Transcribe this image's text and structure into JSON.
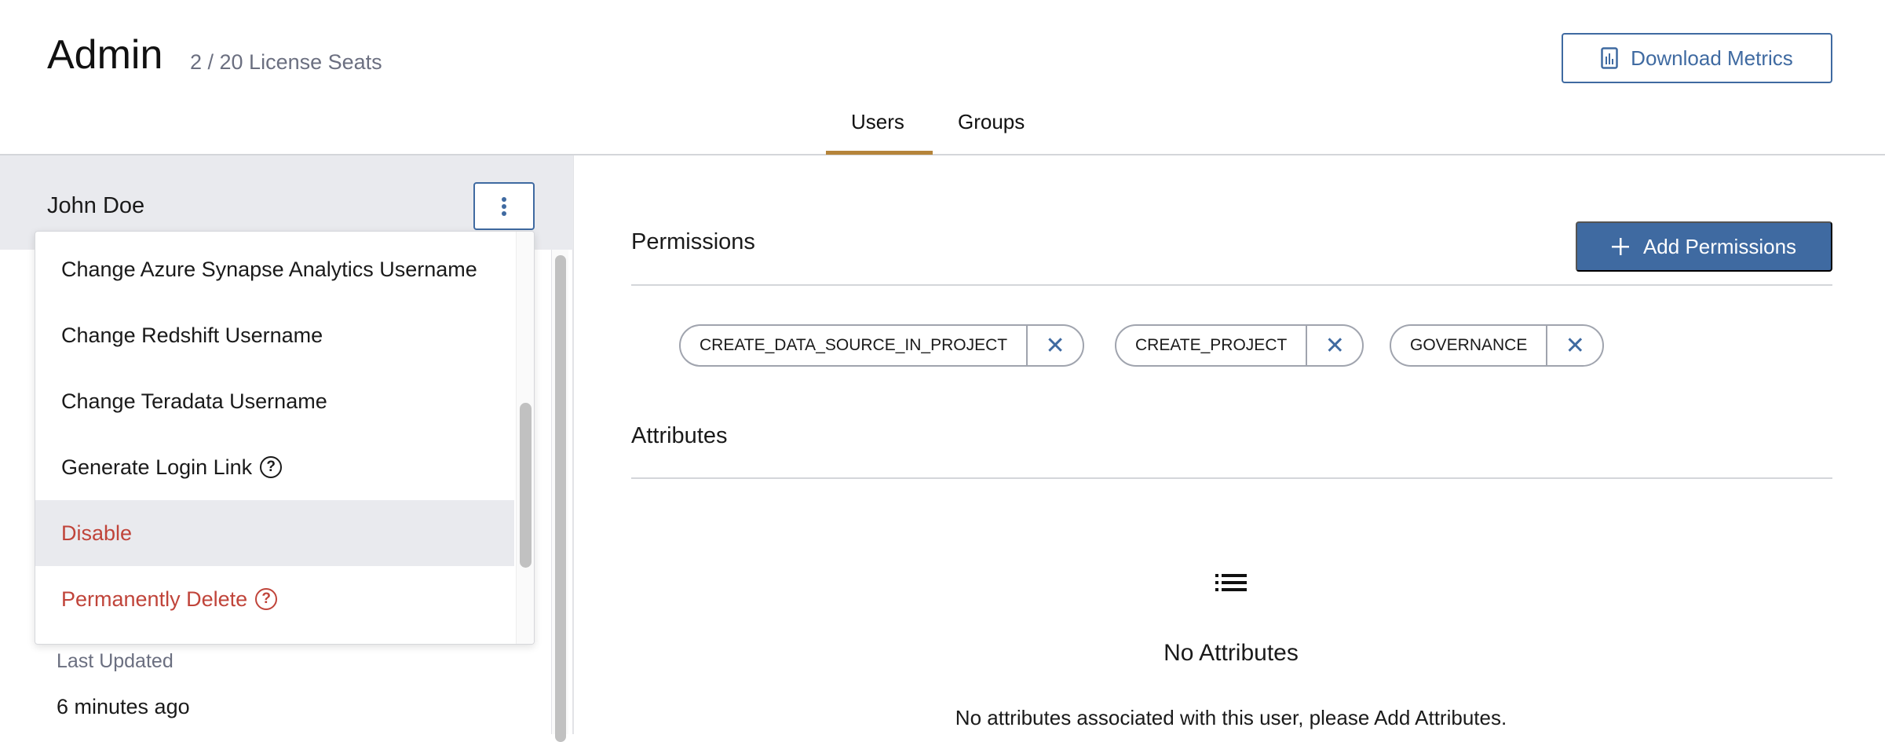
{
  "header": {
    "title": "Admin",
    "seats": "2 / 20 License Seats",
    "download_label": "Download Metrics"
  },
  "tabs": [
    {
      "label": "Users",
      "active": true
    },
    {
      "label": "Groups",
      "active": false
    }
  ],
  "user": {
    "name": "John Doe",
    "last_updated_label": "Last Updated",
    "last_updated_value": "6 minutes ago"
  },
  "menu": {
    "items": [
      {
        "label": "Change Azure Synapse Analytics Username"
      },
      {
        "label": "Change Redshift Username"
      },
      {
        "label": "Change Teradata Username"
      },
      {
        "label": "Generate Login Link",
        "help": true
      },
      {
        "label": "Disable",
        "danger": true,
        "highlighted": true
      },
      {
        "label": "Permanently Delete",
        "help": true,
        "danger": true
      }
    ]
  },
  "permissions": {
    "title": "Permissions",
    "add_label": "Add Permissions",
    "chips": [
      "CREATE_DATA_SOURCE_IN_PROJECT",
      "CREATE_PROJECT",
      "GOVERNANCE"
    ]
  },
  "attributes": {
    "title": "Attributes",
    "empty_title": "No Attributes",
    "empty_desc": "No attributes associated with this user, please Add Attributes."
  },
  "colors": {
    "primary": "#3f6aa1",
    "tab_underline": "#b5843a",
    "danger": "#c0443a"
  }
}
